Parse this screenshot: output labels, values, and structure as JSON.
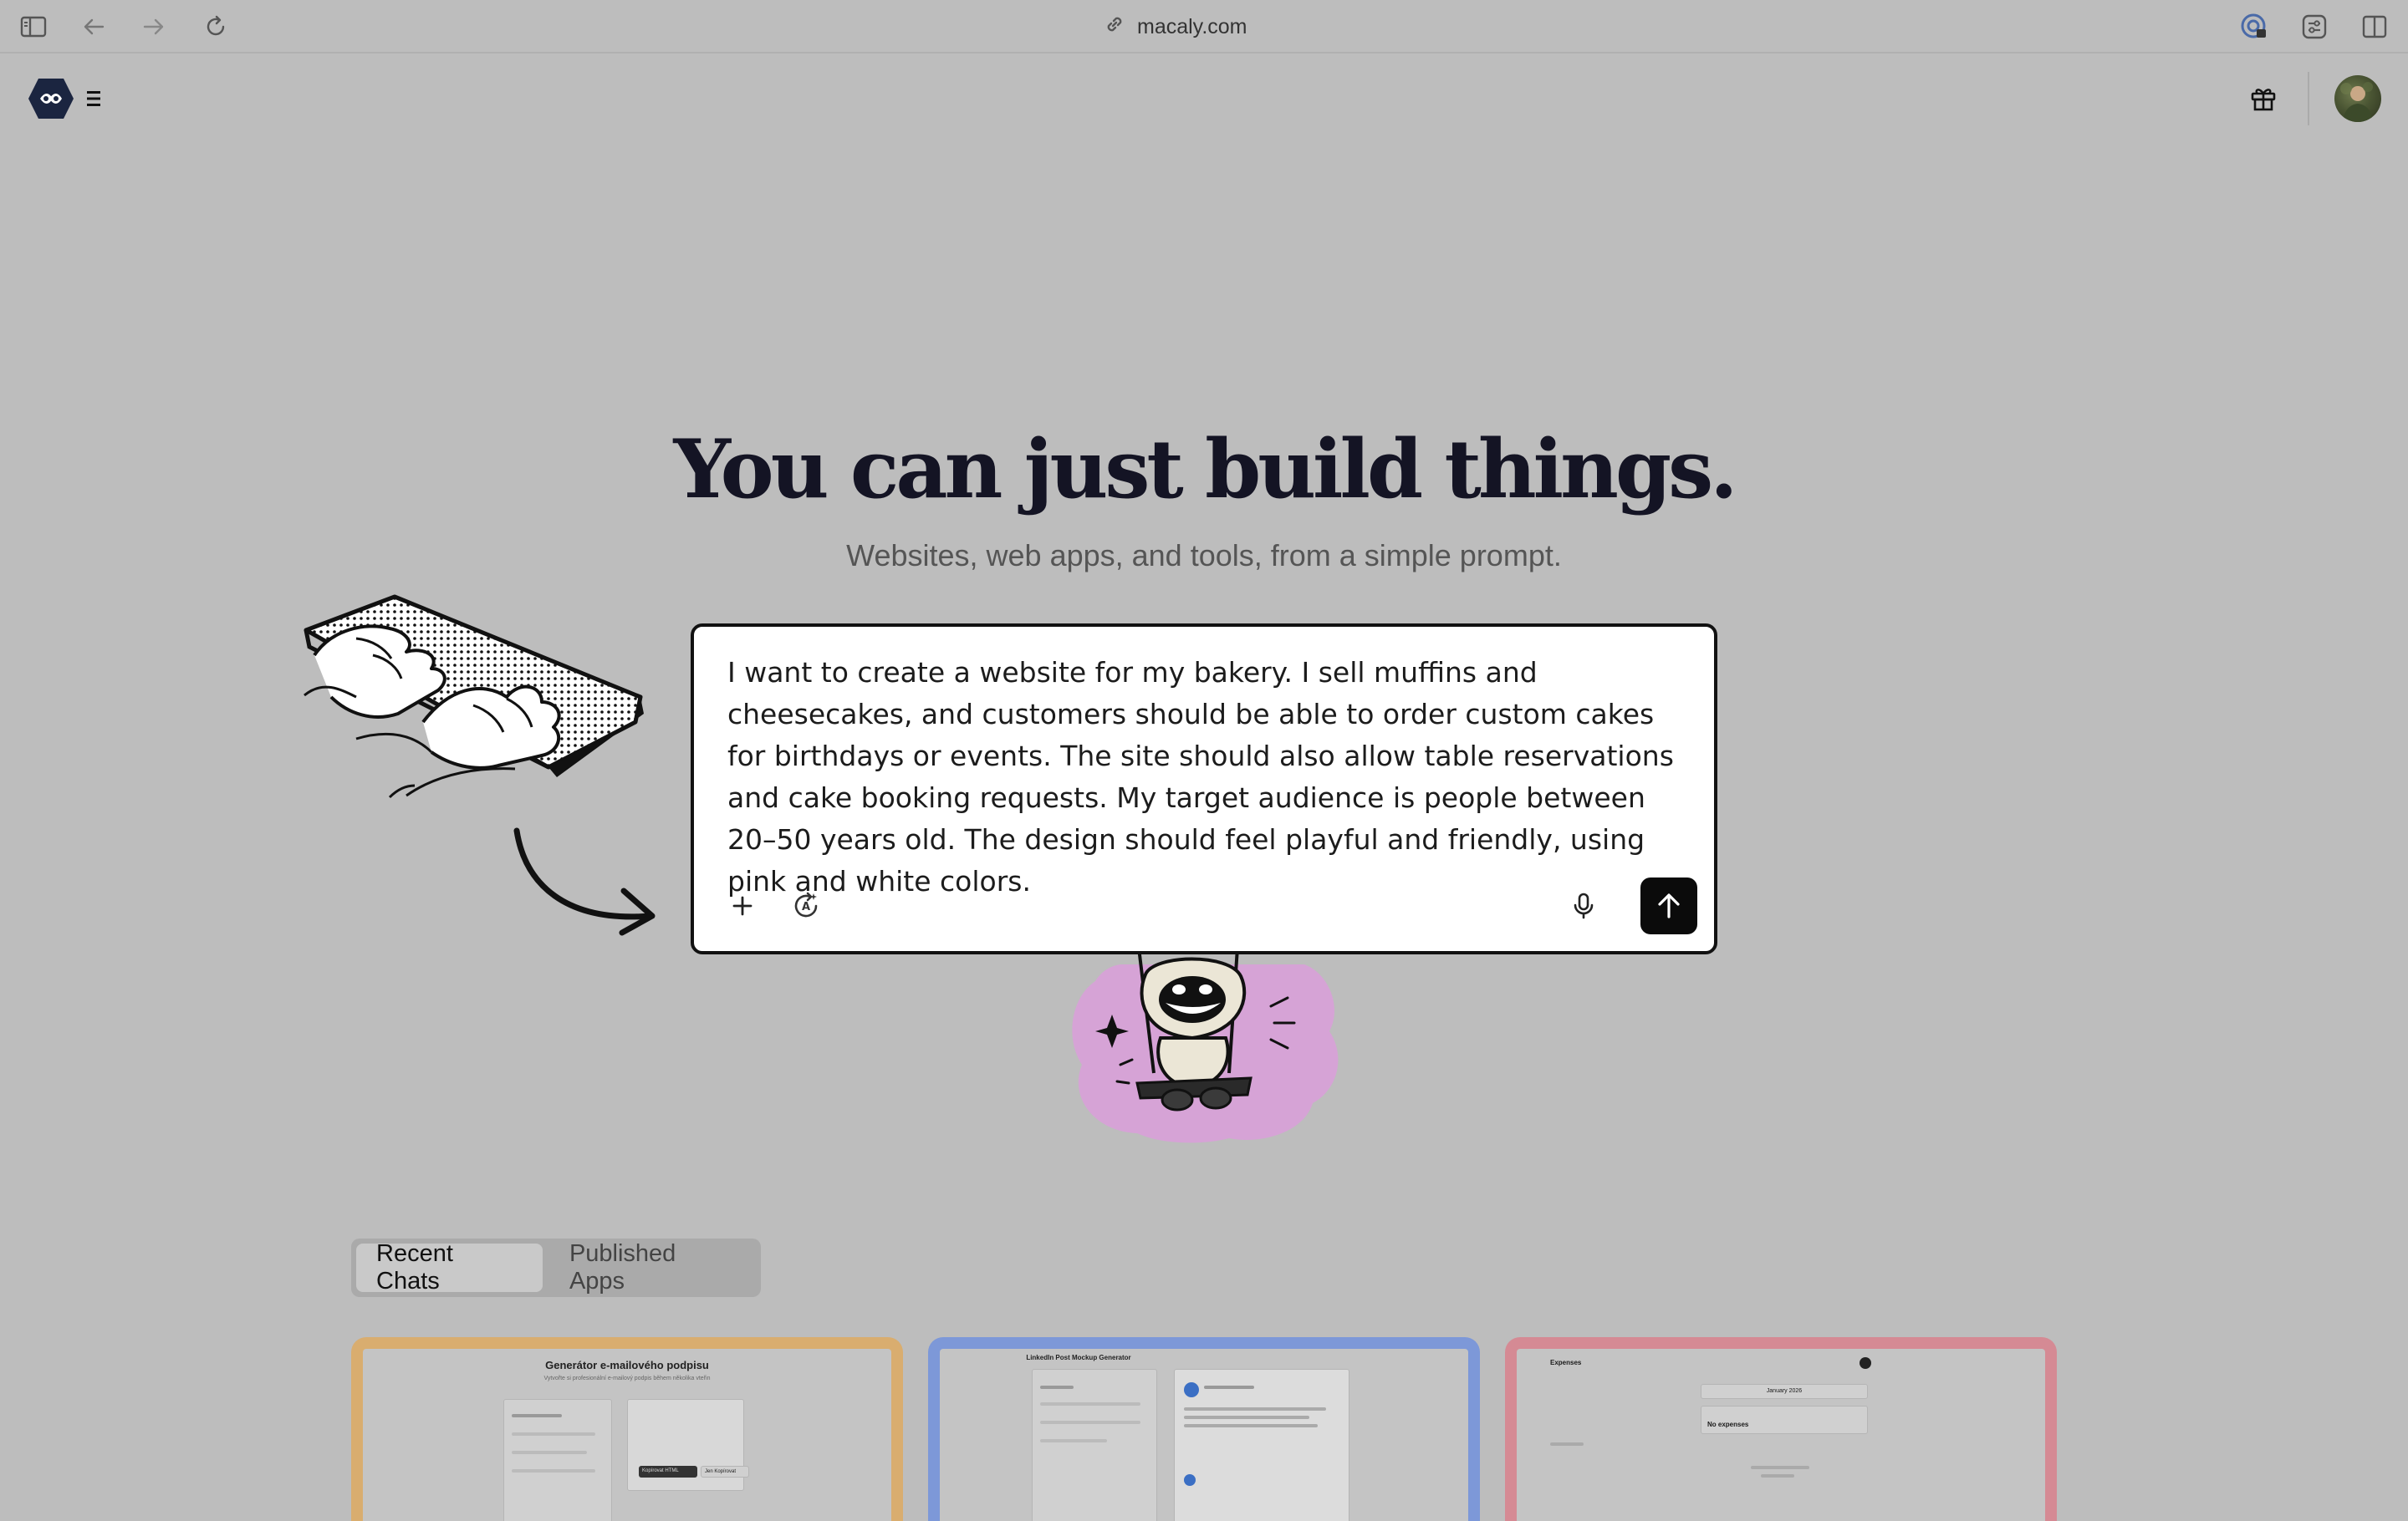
{
  "browser": {
    "url": "macaly.com"
  },
  "hero": {
    "headline": "You can just build things.",
    "subheadline": "Websites, web apps, and tools, from a simple prompt."
  },
  "prompt": {
    "text": "I want to create a website for my bakery. I sell muffins and cheesecakes, and customers should be able to order custom cakes for birthdays or events. The site should also allow table reservations and cake booking requests. My target audience is people between 20–50 years old. The design should feel playful and friendly, using pink and white colors."
  },
  "tabs": [
    {
      "label": "Recent Chats",
      "active": true
    },
    {
      "label": "Published Apps",
      "active": false
    }
  ],
  "cards": [
    {
      "title": "Generátor e-mailového podpisu",
      "subtitle": "Vytvořte si profesionální e-mailový podpis během několika vteřin",
      "border_color": "#d9ad6f",
      "button_labels": [
        "Kopírovat HTML",
        "Jen Kopírovat"
      ]
    },
    {
      "title": "LinkedIn Post Mockup Generator",
      "border_color": "#7d98d8"
    },
    {
      "title": "Expenses",
      "month": "January 2026",
      "empty_title": "No expenses",
      "border_color": "#d58a94"
    }
  ],
  "icons": {
    "sidebar": "sidebar-toggle-icon",
    "back": "back-arrow-icon",
    "forward": "forward-arrow-icon",
    "reload": "reload-icon",
    "link": "link-icon",
    "gift": "gift-icon",
    "menu": "hamburger-menu-icon",
    "plus": "plus-icon",
    "enhance": "ai-enhance-icon",
    "mic": "microphone-icon",
    "send": "arrow-up-icon"
  }
}
